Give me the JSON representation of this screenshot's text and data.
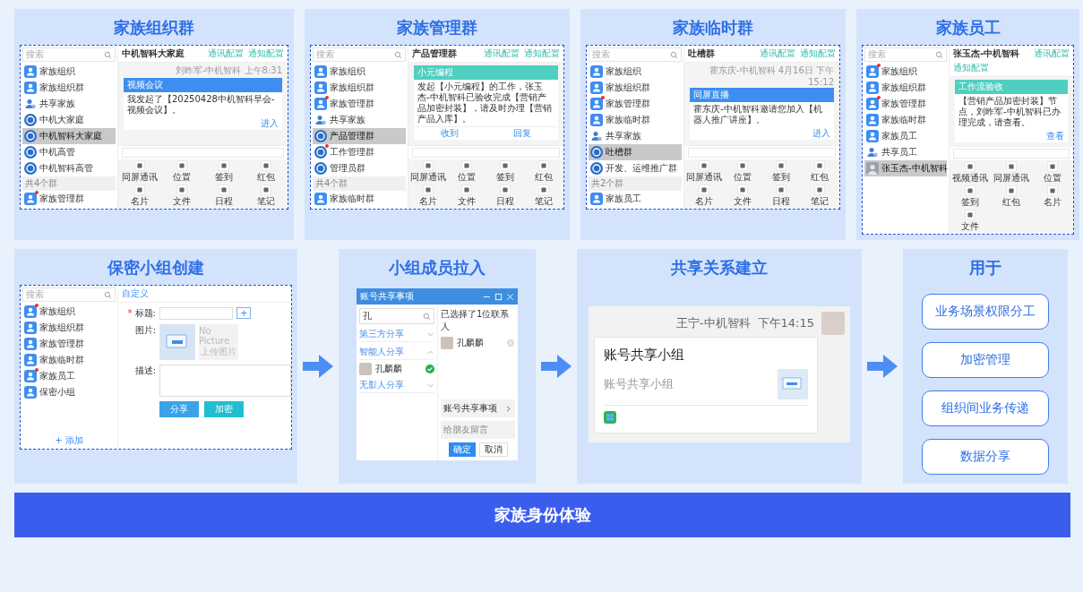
{
  "top_panels": [
    {
      "title": "家族组织群",
      "window": {
        "search_placeholder": "搜索",
        "sidebar": [
          {
            "label": "家族组织",
            "kind": "group",
            "selected": false,
            "dot": false
          },
          {
            "label": "家族组织群",
            "kind": "group",
            "selected": false,
            "dot": false
          },
          {
            "label": "共享家族",
            "kind": "share",
            "selected": false,
            "dot": false
          },
          {
            "label": "中机大家庭",
            "kind": "chat",
            "selected": false,
            "dot": false
          },
          {
            "label": "中机智科大家庭",
            "kind": "chat",
            "selected": true,
            "dot": false
          },
          {
            "label": "中机高管",
            "kind": "chat",
            "selected": false,
            "dot": false
          },
          {
            "label": "中机智科高管",
            "kind": "chat",
            "selected": false,
            "dot": false
          },
          {
            "label": "共4个群",
            "kind": "section"
          },
          {
            "label": "家族管理群",
            "kind": "group",
            "selected": false,
            "dot": true
          }
        ],
        "chat": {
          "title": "中机智科大家庭",
          "actions": [
            "通讯配置",
            "通知配置"
          ],
          "meta": "刘昨军-中机智科 上午8:31",
          "card": {
            "header": "视频会议",
            "color": "#3d8ef0",
            "text": "我发起了【20250428中机智科早会-视频会议】。",
            "link": "进入"
          },
          "tools": [
            "同屏通讯",
            "位置",
            "签到",
            "红包",
            "名片",
            "文件",
            "日程",
            "笔记"
          ]
        }
      }
    },
    {
      "title": "家族管理群",
      "window": {
        "search_placeholder": "搜索",
        "sidebar": [
          {
            "label": "家族组织",
            "kind": "group",
            "selected": false,
            "dot": false
          },
          {
            "label": "家族组织群",
            "kind": "group",
            "selected": false,
            "dot": false
          },
          {
            "label": "家族管理群",
            "kind": "group",
            "selected": false,
            "dot": true
          },
          {
            "label": "共享家族",
            "kind": "share",
            "selected": false,
            "dot": false
          },
          {
            "label": "产品管理群",
            "kind": "chat",
            "selected": true,
            "dot": false
          },
          {
            "label": "工作管理群",
            "kind": "chat",
            "selected": false,
            "dot": true
          },
          {
            "label": "管理员群",
            "kind": "chat",
            "selected": false,
            "dot": false
          },
          {
            "label": "共4个群",
            "kind": "section"
          },
          {
            "label": "家族临时群",
            "kind": "group",
            "selected": false,
            "dot": false
          }
        ],
        "chat": {
          "title": "产品管理群",
          "actions": [
            "通讯配置",
            "通知配置"
          ],
          "card": {
            "header": "小元编程",
            "color": "#4fcfc0",
            "text": "发起【小元编程】的工作，张玉杰-中机智科已验收完成【营销产品加密封装】，请及时办理【营销产品入库】。",
            "buttons": [
              "收到",
              "回复"
            ]
          },
          "tools": [
            "同屏通讯",
            "位置",
            "签到",
            "红包",
            "名片",
            "文件",
            "日程",
            "笔记"
          ]
        }
      }
    },
    {
      "title": "家族临时群",
      "window": {
        "search_placeholder": "搜索",
        "sidebar": [
          {
            "label": "家族组织",
            "kind": "group",
            "selected": false,
            "dot": false
          },
          {
            "label": "家族组织群",
            "kind": "group",
            "selected": false,
            "dot": false
          },
          {
            "label": "家族管理群",
            "kind": "group",
            "selected": false,
            "dot": true
          },
          {
            "label": "家族临时群",
            "kind": "group",
            "selected": false,
            "dot": false
          },
          {
            "label": "共享家族",
            "kind": "share",
            "selected": false,
            "dot": false
          },
          {
            "label": "吐槽群",
            "kind": "chat",
            "selected": true,
            "dot": false
          },
          {
            "label": "开发、运维推广群",
            "kind": "chat",
            "selected": false,
            "dot": false
          },
          {
            "label": "共2个群",
            "kind": "section"
          },
          {
            "label": "家族员工",
            "kind": "group",
            "selected": false,
            "dot": false
          }
        ],
        "chat": {
          "title": "吐槽群",
          "actions": [
            "通讯配置",
            "通知配置"
          ],
          "meta": "霍东庆-中机智科 4月16日 下午15:12",
          "card": {
            "header": "同屏直播",
            "color": "#3d8ef0",
            "text": "霍东庆-中机智科邀请您加入【机器人推广讲座】。",
            "link": "进入"
          },
          "tools": [
            "同屏通讯",
            "位置",
            "签到",
            "红包",
            "名片",
            "文件",
            "日程",
            "笔记"
          ]
        }
      }
    },
    {
      "title": "家族员工",
      "window": {
        "search_placeholder": "搜索",
        "sidebar": [
          {
            "label": "家族组织",
            "kind": "group",
            "selected": false,
            "dot": true
          },
          {
            "label": "家族组织群",
            "kind": "group",
            "selected": false,
            "dot": false
          },
          {
            "label": "家族管理群",
            "kind": "group",
            "selected": false,
            "dot": true
          },
          {
            "label": "家族临时群",
            "kind": "group",
            "selected": false,
            "dot": false
          },
          {
            "label": "家族员工",
            "kind": "group",
            "selected": false,
            "dot": false
          },
          {
            "label": "共享员工",
            "kind": "share",
            "selected": false,
            "dot": false
          },
          {
            "label": "张玉杰-中机智科",
            "kind": "contact",
            "selected": true,
            "dot": false
          }
        ],
        "chat": {
          "title": "张玉杰-中机智科",
          "actions": [
            "通讯配置",
            "通知配置"
          ],
          "card": {
            "header": "工作流验收",
            "color": "#4fcfc0",
            "text": "【营销产品加密封装】节点，刘昨军-中机智科已办理完成，请查看。",
            "link": "查看"
          },
          "tools": [
            "视频通讯",
            "同屏通讯",
            "位置",
            "签到",
            "红包",
            "名片",
            "文件"
          ]
        }
      }
    }
  ],
  "steps": [
    {
      "kind": "create",
      "title": "保密小组创建",
      "window": {
        "search_placeholder": "搜索",
        "sidebar": [
          {
            "label": "家族组织",
            "kind": "group",
            "selected": false,
            "dot": true
          },
          {
            "label": "家族组织群",
            "kind": "group",
            "selected": false,
            "dot": false
          },
          {
            "label": "家族管理群",
            "kind": "group",
            "selected": false,
            "dot": false
          },
          {
            "label": "家族临时群",
            "kind": "group",
            "selected": false,
            "dot": false
          },
          {
            "label": "家族员工",
            "kind": "group",
            "selected": false,
            "dot": true
          },
          {
            "label": "保密小组",
            "kind": "group",
            "selected": false,
            "dot": false
          }
        ],
        "add_label": "+ 添加",
        "tab": "自定义",
        "required_mark": "*",
        "title_label": "标题:",
        "add_button": "+",
        "image_label": "图片:",
        "no_picture": "No Picture",
        "upload": "上传图片",
        "desc_label": "描述:",
        "buttons": [
          "分享",
          "加密"
        ]
      }
    },
    {
      "kind": "dialog",
      "title": "小组成员拉入",
      "dialog": {
        "title": "账号共享事项",
        "search_value": "孔",
        "groups": [
          {
            "label": "第三方分享",
            "expanded": false
          },
          {
            "label": "智能人分享",
            "expanded": true,
            "members": [
              {
                "name": "孔麟麟",
                "checked": true
              }
            ]
          },
          {
            "label": "无影人分享",
            "expanded": false
          }
        ],
        "selected_text": "已选择了1位联系人",
        "selected": [
          "孔麟麟"
        ],
        "matter": "账号共享事项",
        "message_placeholder": "给朋友留言",
        "ok": "确定",
        "cancel": "取消"
      }
    },
    {
      "kind": "share",
      "title": "共享关系建立",
      "message": {
        "sender": "王宁-中机智科",
        "time": "下午14:15",
        "card_title": "账号共享小组",
        "card_subtitle": "账号共享小组"
      }
    },
    {
      "kind": "uses",
      "title": "用于",
      "items": [
        "业务场景权限分工",
        "加密管理",
        "组织间业务传递",
        "数据分享"
      ]
    }
  ],
  "footer": "家族身份体验"
}
